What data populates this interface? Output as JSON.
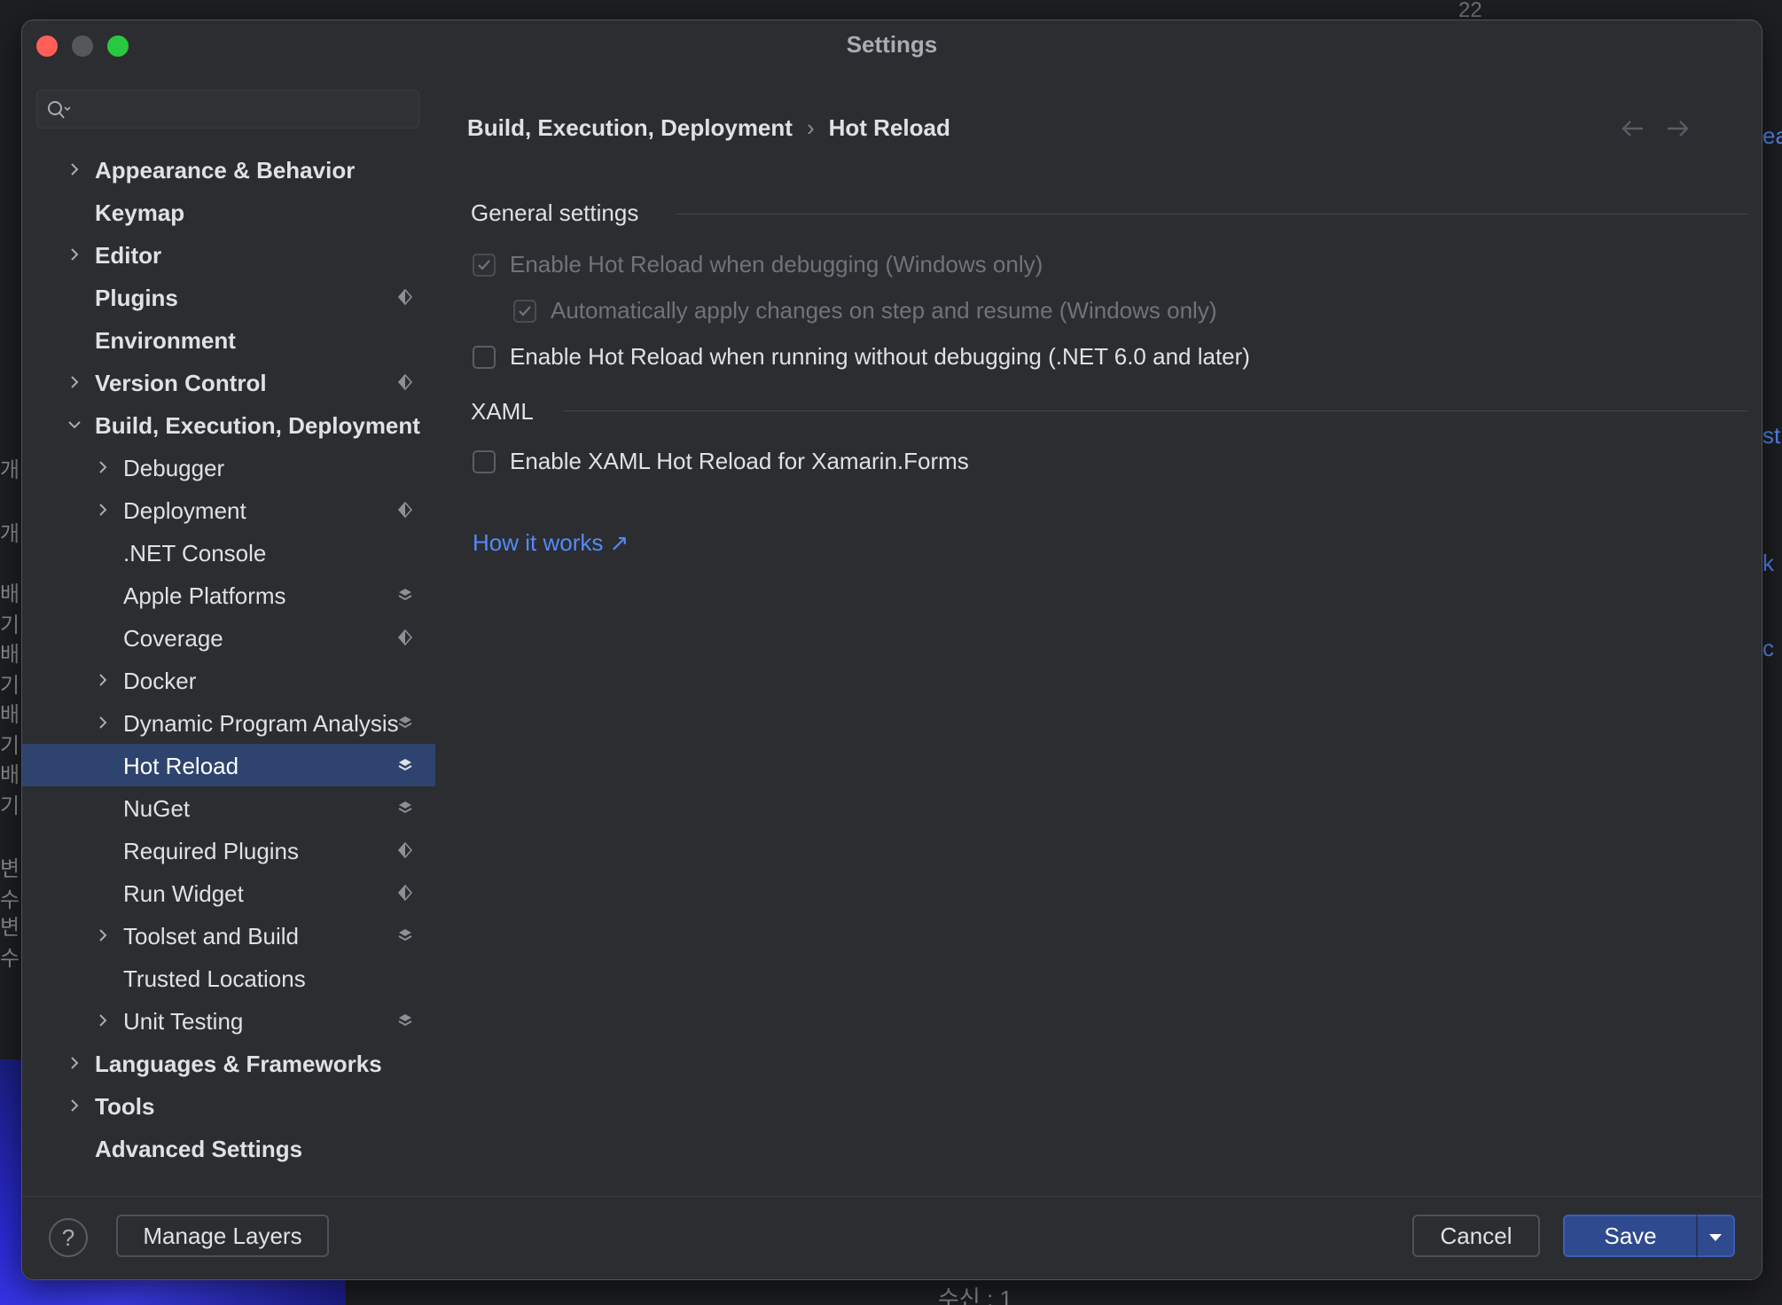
{
  "window": {
    "title": "Settings"
  },
  "background": {
    "top_number": "22",
    "bottom_text": "수신 : 1",
    "left_fragments": [
      "개 ",
      "개",
      "배기",
      "배기",
      "배기",
      "배기",
      "변수",
      "변수"
    ],
    "right_fragments": [
      "ea",
      "st",
      "k",
      "c"
    ]
  },
  "search": {
    "placeholder": "",
    "value": ""
  },
  "sidebar": {
    "items": [
      {
        "label": "Appearance & Behavior",
        "level": 0,
        "expandable": true,
        "expanded": false,
        "badge": ""
      },
      {
        "label": "Keymap",
        "level": 0,
        "expandable": false,
        "badge": ""
      },
      {
        "label": "Editor",
        "level": 0,
        "expandable": true,
        "expanded": false,
        "badge": ""
      },
      {
        "label": "Plugins",
        "level": 0,
        "expandable": false,
        "badge": "ide"
      },
      {
        "label": "Environment",
        "level": 0,
        "expandable": false,
        "badge": ""
      },
      {
        "label": "Version Control",
        "level": 0,
        "expandable": true,
        "expanded": false,
        "badge": "ide"
      },
      {
        "label": "Build, Execution, Deployment",
        "level": 0,
        "expandable": true,
        "expanded": true,
        "badge": ""
      },
      {
        "label": "Debugger",
        "level": 1,
        "expandable": true,
        "expanded": false,
        "badge": ""
      },
      {
        "label": "Deployment",
        "level": 1,
        "expandable": true,
        "expanded": false,
        "badge": "ide"
      },
      {
        "label": ".NET Console",
        "level": 1,
        "expandable": false,
        "badge": ""
      },
      {
        "label": "Apple Platforms",
        "level": 1,
        "expandable": false,
        "badge": "layers"
      },
      {
        "label": "Coverage",
        "level": 1,
        "expandable": false,
        "badge": "ide"
      },
      {
        "label": "Docker",
        "level": 1,
        "expandable": true,
        "expanded": false,
        "badge": ""
      },
      {
        "label": "Dynamic Program Analysis",
        "level": 1,
        "expandable": true,
        "expanded": false,
        "badge": "layers"
      },
      {
        "label": "Hot Reload",
        "level": 1,
        "expandable": false,
        "badge": "layers",
        "selected": true
      },
      {
        "label": "NuGet",
        "level": 1,
        "expandable": false,
        "badge": "layers"
      },
      {
        "label": "Required Plugins",
        "level": 1,
        "expandable": false,
        "badge": "ide"
      },
      {
        "label": "Run Widget",
        "level": 1,
        "expandable": false,
        "badge": "ide"
      },
      {
        "label": "Toolset and Build",
        "level": 1,
        "expandable": true,
        "expanded": false,
        "badge": "layers"
      },
      {
        "label": "Trusted Locations",
        "level": 1,
        "expandable": false,
        "badge": ""
      },
      {
        "label": "Unit Testing",
        "level": 1,
        "expandable": true,
        "expanded": false,
        "badge": "layers"
      },
      {
        "label": "Languages & Frameworks",
        "level": 0,
        "expandable": true,
        "expanded": false,
        "badge": ""
      },
      {
        "label": "Tools",
        "level": 0,
        "expandable": true,
        "expanded": false,
        "badge": ""
      },
      {
        "label": "Advanced Settings",
        "level": 0,
        "expandable": false,
        "badge": ""
      }
    ]
  },
  "breadcrumb": {
    "parent": "Build, Execution, Deployment",
    "separator": "›",
    "current": "Hot Reload"
  },
  "general": {
    "title": "General settings",
    "options": [
      {
        "label": "Enable Hot Reload when debugging (Windows only)",
        "checked": true,
        "disabled": true
      },
      {
        "label": "Automatically apply changes on step and resume (Windows only)",
        "checked": true,
        "disabled": true
      },
      {
        "label": "Enable Hot Reload when running without debugging (.NET 6.0 and later)",
        "checked": false,
        "disabled": false
      }
    ]
  },
  "xaml": {
    "title": "XAML",
    "options": [
      {
        "label": "Enable XAML Hot Reload for Xamarin.Forms",
        "checked": false,
        "disabled": false
      }
    ]
  },
  "link": {
    "label": "How it works ↗"
  },
  "footer": {
    "help_label": "?",
    "manage_layers_label": "Manage Layers",
    "cancel_label": "Cancel",
    "save_label": "Save"
  },
  "colors": {
    "dialog_bg": "#2b2d30",
    "selection": "#2e436e",
    "link": "#548af7",
    "primary_button": "#2f4a8e"
  }
}
